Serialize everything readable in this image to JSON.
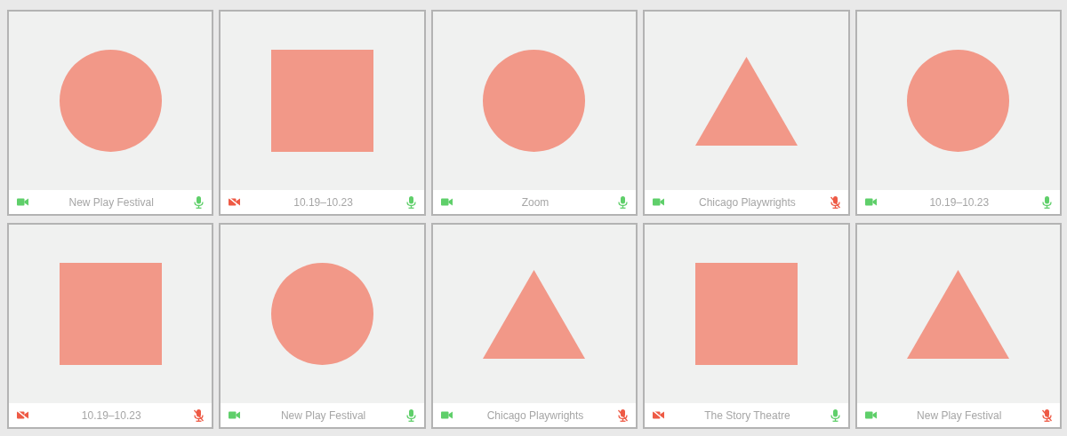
{
  "tiles": [
    {
      "kind": "circle",
      "label": "New Play Festival",
      "video_on": true,
      "mic_on": true
    },
    {
      "kind": "square",
      "label": "10.19–10.23",
      "video_on": false,
      "mic_on": true
    },
    {
      "kind": "circle",
      "label": "Zoom",
      "video_on": true,
      "mic_on": true
    },
    {
      "kind": "triangle",
      "label": "Chicago Playwrights",
      "video_on": true,
      "mic_on": false
    },
    {
      "kind": "circle",
      "label": "10.19–10.23",
      "video_on": true,
      "mic_on": true
    },
    {
      "kind": "square",
      "label": "10.19–10.23",
      "video_on": false,
      "mic_on": false
    },
    {
      "kind": "circle",
      "label": "New Play Festival",
      "video_on": true,
      "mic_on": true
    },
    {
      "kind": "triangle",
      "label": "Chicago Playwrights",
      "video_on": true,
      "mic_on": false
    },
    {
      "kind": "square",
      "label": "The Story Theatre",
      "video_on": false,
      "mic_on": true
    },
    {
      "kind": "triangle",
      "label": "New Play Festival",
      "video_on": true,
      "mic_on": false
    }
  ]
}
